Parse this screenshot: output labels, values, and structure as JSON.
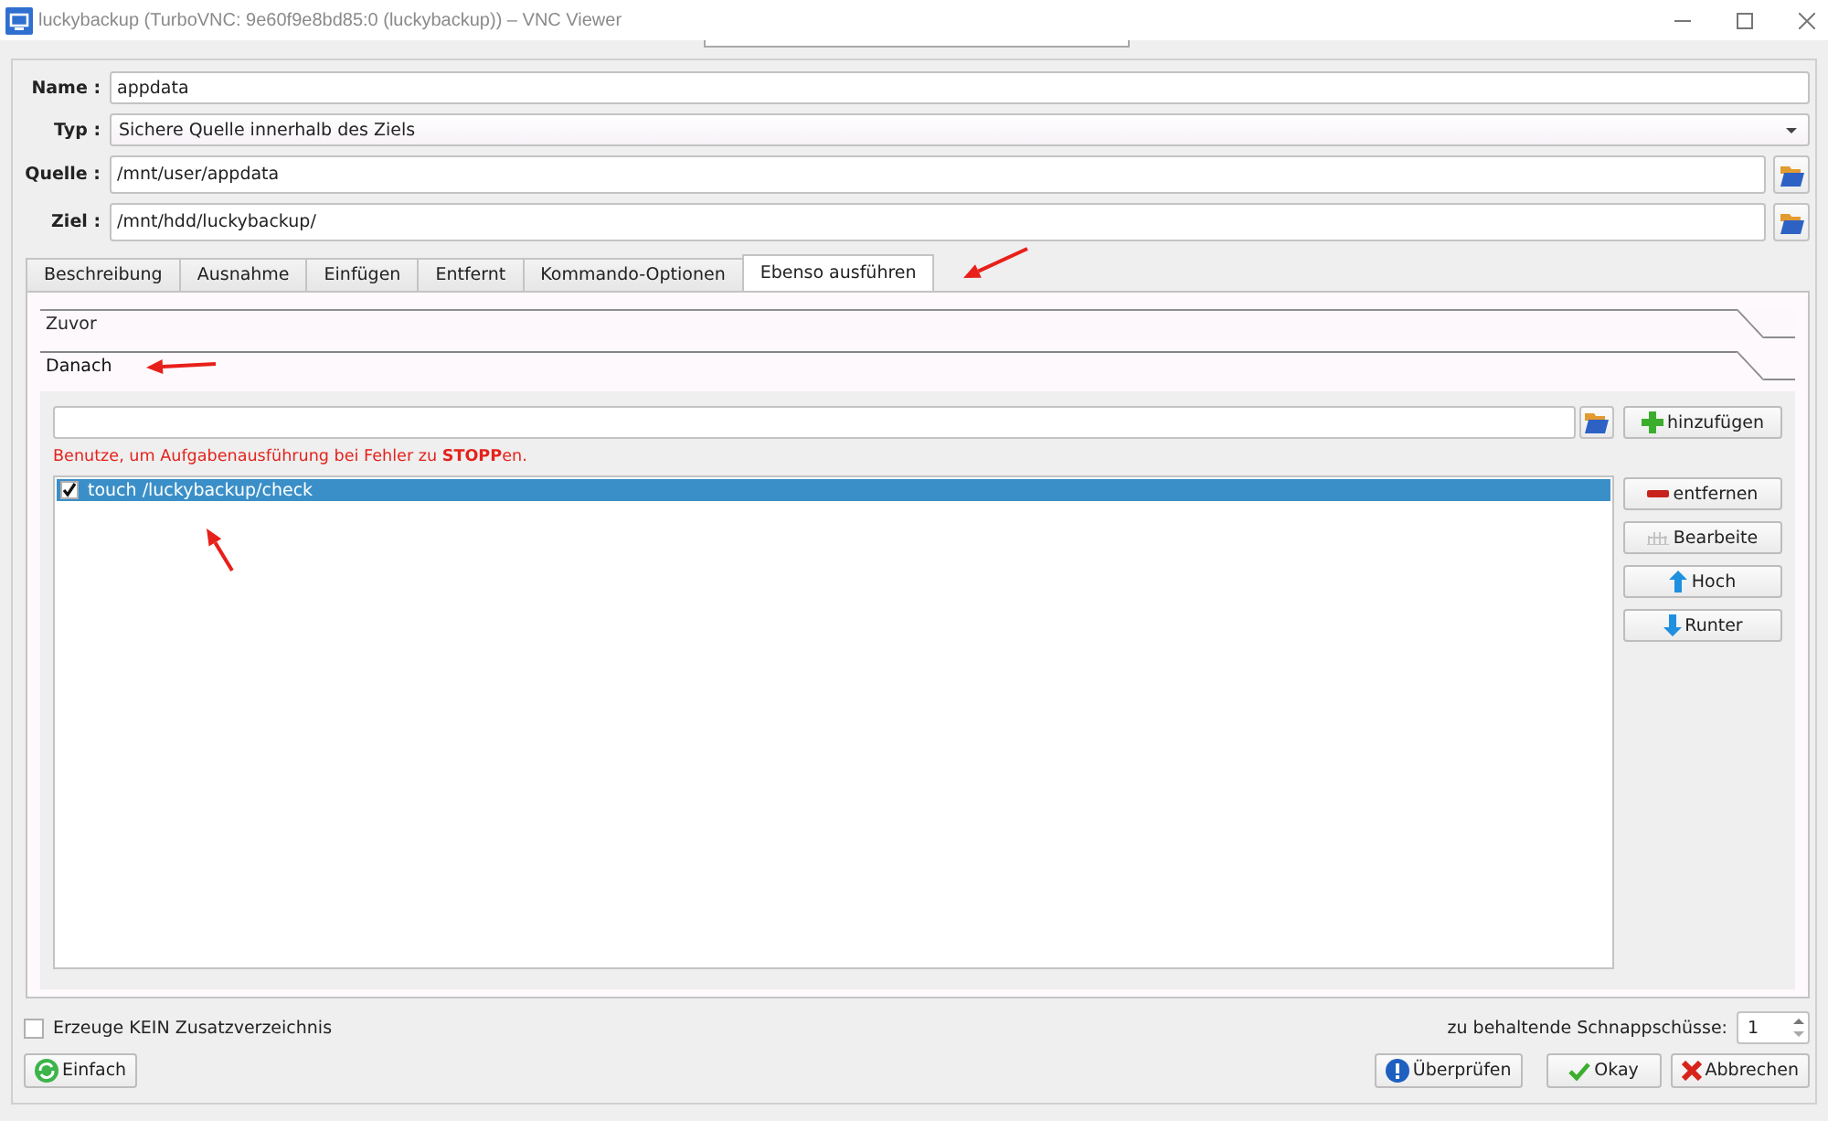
{
  "window": {
    "title": "luckybackup (TurboVNC: 9e60f9e8bd85:0 (luckybackup)) – VNC Viewer"
  },
  "fields": [
    {
      "kind": "text",
      "label": "Name :",
      "value": "appdata"
    },
    {
      "kind": "combo",
      "label": "Typ :",
      "value": "Sichere Quelle innerhalb des Ziels"
    },
    {
      "kind": "path",
      "label": "Quelle :",
      "value": "/mnt/user/appdata"
    },
    {
      "kind": "path",
      "label": "Ziel :",
      "value": "/mnt/hdd/luckybackup/"
    }
  ],
  "tabs": [
    {
      "label": "Beschreibung",
      "selected": false
    },
    {
      "label": "Ausnahme",
      "selected": false
    },
    {
      "label": "Einfügen",
      "selected": false
    },
    {
      "label": "Entfernt",
      "selected": false
    },
    {
      "label": "Kommando-Optionen",
      "selected": false
    },
    {
      "label": "Ebenso ausführen",
      "selected": true
    }
  ],
  "sections": [
    {
      "title": "Zuvor",
      "expanded": false
    },
    {
      "title": "Danach",
      "expanded": true,
      "content": {
        "add_button": "hinzufügen",
        "hint": "Benutze, um Aufgabenausführung bei Fehler zu **STOPP**en.",
        "commands": [
          {
            "text": "touch /luckybackup/check",
            "checked": true,
            "selected": true
          }
        ],
        "buttons": [
          "entfernen",
          "Bearbeite",
          "Hoch",
          "Runter"
        ]
      }
    }
  ],
  "options": {
    "no_extra_dir": {
      "label": "Erzeuge KEIN Zusatzverzeichnis",
      "checked": false
    },
    "snapshots": {
      "label": "zu behaltende Schnappschüsse:",
      "value": "1"
    }
  },
  "footer": {
    "left_buttons": [
      "Einfach"
    ],
    "right_buttons": [
      "Überprüfen",
      "Okay",
      "Abbrechen"
    ]
  }
}
